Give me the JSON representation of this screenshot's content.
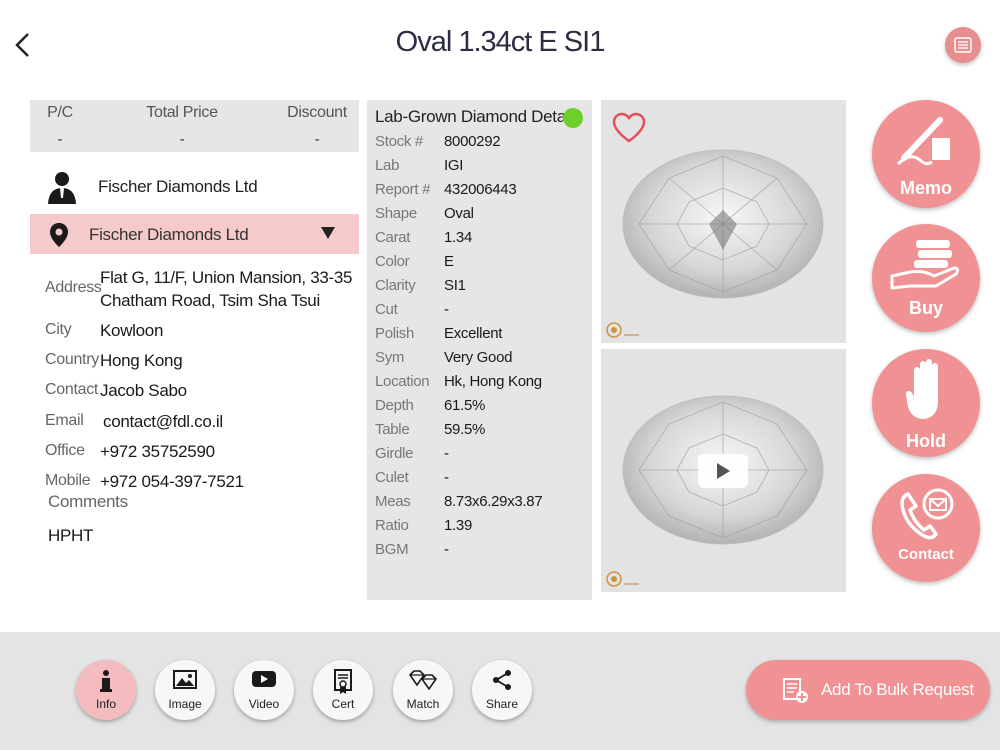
{
  "header": {
    "title": "Oval 1.34ct E SI1"
  },
  "pricing": {
    "pc_label": "P/C",
    "pc_value": "-",
    "total_label": "Total Price",
    "total_value": "-",
    "discount_label": "Discount",
    "discount_value": "-"
  },
  "seller": {
    "name": "Fischer Diamonds Ltd",
    "location_name": "Fischer Diamonds Ltd"
  },
  "contact_info": {
    "address_label": "Address",
    "address_line1": "Flat G, 11/F, Union Mansion, 33-35",
    "address_line2": "Chatham Road, Tsim Sha Tsui",
    "city_label": "City",
    "city": "Kowloon",
    "country_label": "Country",
    "country": "Hong Kong",
    "contact_label": "Contact",
    "contact": "Jacob Sabo",
    "email_label": "Email",
    "email": "contact@fdl.co.il",
    "office_label": "Office",
    "office": "+972 35752590",
    "mobile_label": "Mobile",
    "mobile": "+972 054-397-7521",
    "comments_label": "Comments",
    "comments": "HPHT"
  },
  "details": {
    "title": "Lab-Grown Diamond Details",
    "status_color": "#6fcf2a",
    "rows": [
      {
        "label": "Stock #",
        "value": "8000292"
      },
      {
        "label": "Lab",
        "value": "IGI"
      },
      {
        "label": "Report #",
        "value": "432006443"
      },
      {
        "label": "Shape",
        "value": "Oval"
      },
      {
        "label": "Carat",
        "value": "1.34"
      },
      {
        "label": "Color",
        "value": "E"
      },
      {
        "label": "Clarity",
        "value": "SI1"
      },
      {
        "label": "Cut",
        "value": "-"
      },
      {
        "label": "Polish",
        "value": "Excellent"
      },
      {
        "label": "Sym",
        "value": "Very Good"
      },
      {
        "label": "Location",
        "value": "Hk, Hong Kong"
      },
      {
        "label": "Depth",
        "value": "61.5%"
      },
      {
        "label": "Table",
        "value": "59.5%"
      },
      {
        "label": "Girdle",
        "value": "-"
      },
      {
        "label": "Culet",
        "value": "-"
      },
      {
        "label": "Meas",
        "value": "8.73x6.29x3.87"
      },
      {
        "label": "Ratio",
        "value": "1.39"
      },
      {
        "label": "BGM",
        "value": "-"
      }
    ]
  },
  "actions": {
    "memo": "Memo",
    "buy": "Buy",
    "hold": "Hold",
    "contact": "Contact"
  },
  "toolbar": {
    "info": "Info",
    "image": "Image",
    "video": "Video",
    "cert": "Cert",
    "match": "Match",
    "share": "Share",
    "bulk": "Add To Bulk Request"
  },
  "colors": {
    "accent": "#f09193",
    "highlight": "#f6c9cb",
    "panel": "#e6e6e6"
  }
}
